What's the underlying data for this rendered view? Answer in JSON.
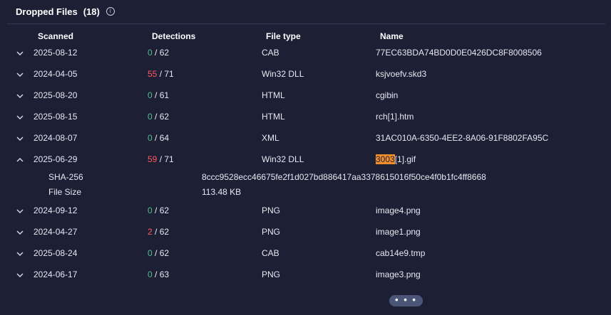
{
  "section": {
    "title": "Dropped Files",
    "count": "(18)",
    "info_icon": "i"
  },
  "columns": {
    "scanned": "Scanned",
    "detections": "Detections",
    "file_type": "File type",
    "name": "Name"
  },
  "rows": [
    {
      "date": "2025-08-12",
      "det": "0",
      "total": "/ 62",
      "type": "CAB",
      "name": "77EC63BDA74BD0D0E0426DC8F8008506",
      "expanded": false
    },
    {
      "date": "2024-04-05",
      "det": "55",
      "total": "/ 71",
      "type": "Win32 DLL",
      "name": "ksjvoefv.skd3",
      "expanded": false
    },
    {
      "date": "2025-08-20",
      "det": "0",
      "total": "/ 61",
      "type": "HTML",
      "name": "cgibin",
      "expanded": false
    },
    {
      "date": "2025-08-15",
      "det": "0",
      "total": "/ 62",
      "type": "HTML",
      "name": "rch[1].htm",
      "expanded": false
    },
    {
      "date": "2024-08-07",
      "det": "0",
      "total": "/ 64",
      "type": "XML",
      "name": "31AC010A-6350-4EE2-8A06-91F8802FA95C",
      "expanded": false
    },
    {
      "date": "2025-06-29",
      "det": "59",
      "total": "/ 71",
      "type": "Win32 DLL",
      "name_highlight": "3003",
      "name_rest": "[1].gif",
      "expanded": true
    },
    {
      "date": "2024-09-12",
      "det": "0",
      "total": "/ 62",
      "type": "PNG",
      "name": "image4.png",
      "expanded": false
    },
    {
      "date": "2024-04-27",
      "det": "2",
      "total": "/ 62",
      "type": "PNG",
      "name": "image1.png",
      "expanded": false
    },
    {
      "date": "2025-08-24",
      "det": "0",
      "total": "/ 62",
      "type": "CAB",
      "name": "cab14e9.tmp",
      "expanded": false
    },
    {
      "date": "2024-06-17",
      "det": "0",
      "total": "/ 63",
      "type": "PNG",
      "name": "image3.png",
      "expanded": false
    }
  ],
  "details": {
    "sha256_label": "SHA-256",
    "sha256_value": "8ccc9528ecc46675fe2f1d027bd886417aa3378615016f50ce4f0b1fc4ff8668",
    "filesize_label": "File Size",
    "filesize_value": "113.48 KB"
  },
  "more_button": "• • •",
  "colors": {
    "background": "#1d1f35",
    "clean": "#4fbf8f",
    "malicious": "#ff5a5f",
    "highlight": "#f08f2c"
  }
}
